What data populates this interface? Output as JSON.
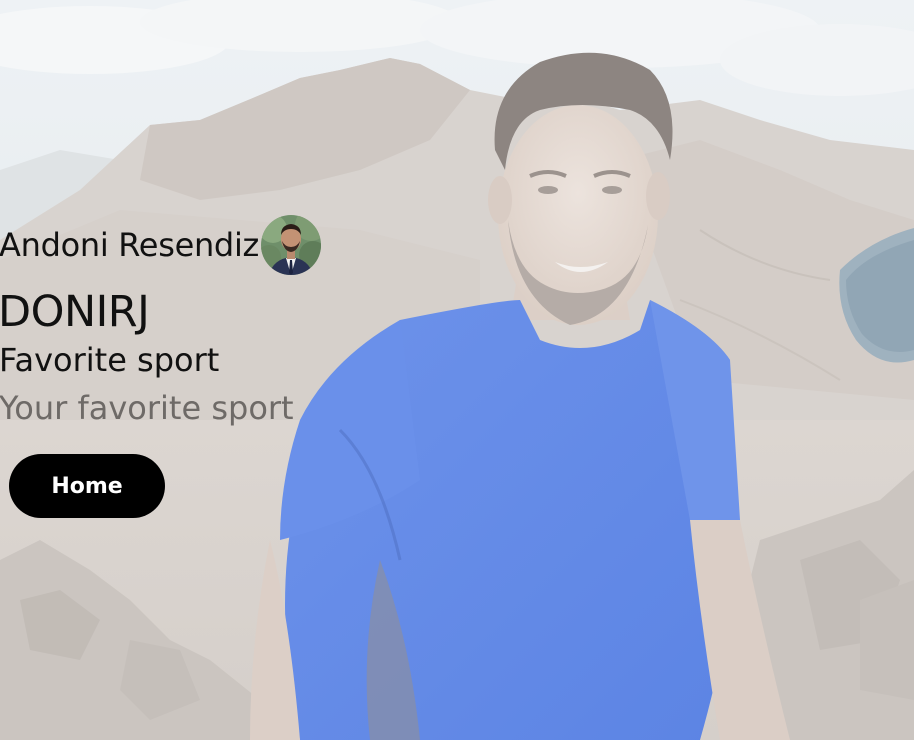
{
  "profile": {
    "full_name": "Andoni Resendiz",
    "username": "DONIRJ",
    "avatar_icon": "avatar-photo"
  },
  "favorite_sport": {
    "label": "Favorite sport",
    "value": "",
    "placeholder": "Your favorite sport"
  },
  "nav": {
    "home_label": "Home"
  },
  "colors": {
    "button_bg": "#000000",
    "button_text": "#ffffff",
    "shirt": "#5d86e6",
    "sky": "#e7ecef"
  }
}
